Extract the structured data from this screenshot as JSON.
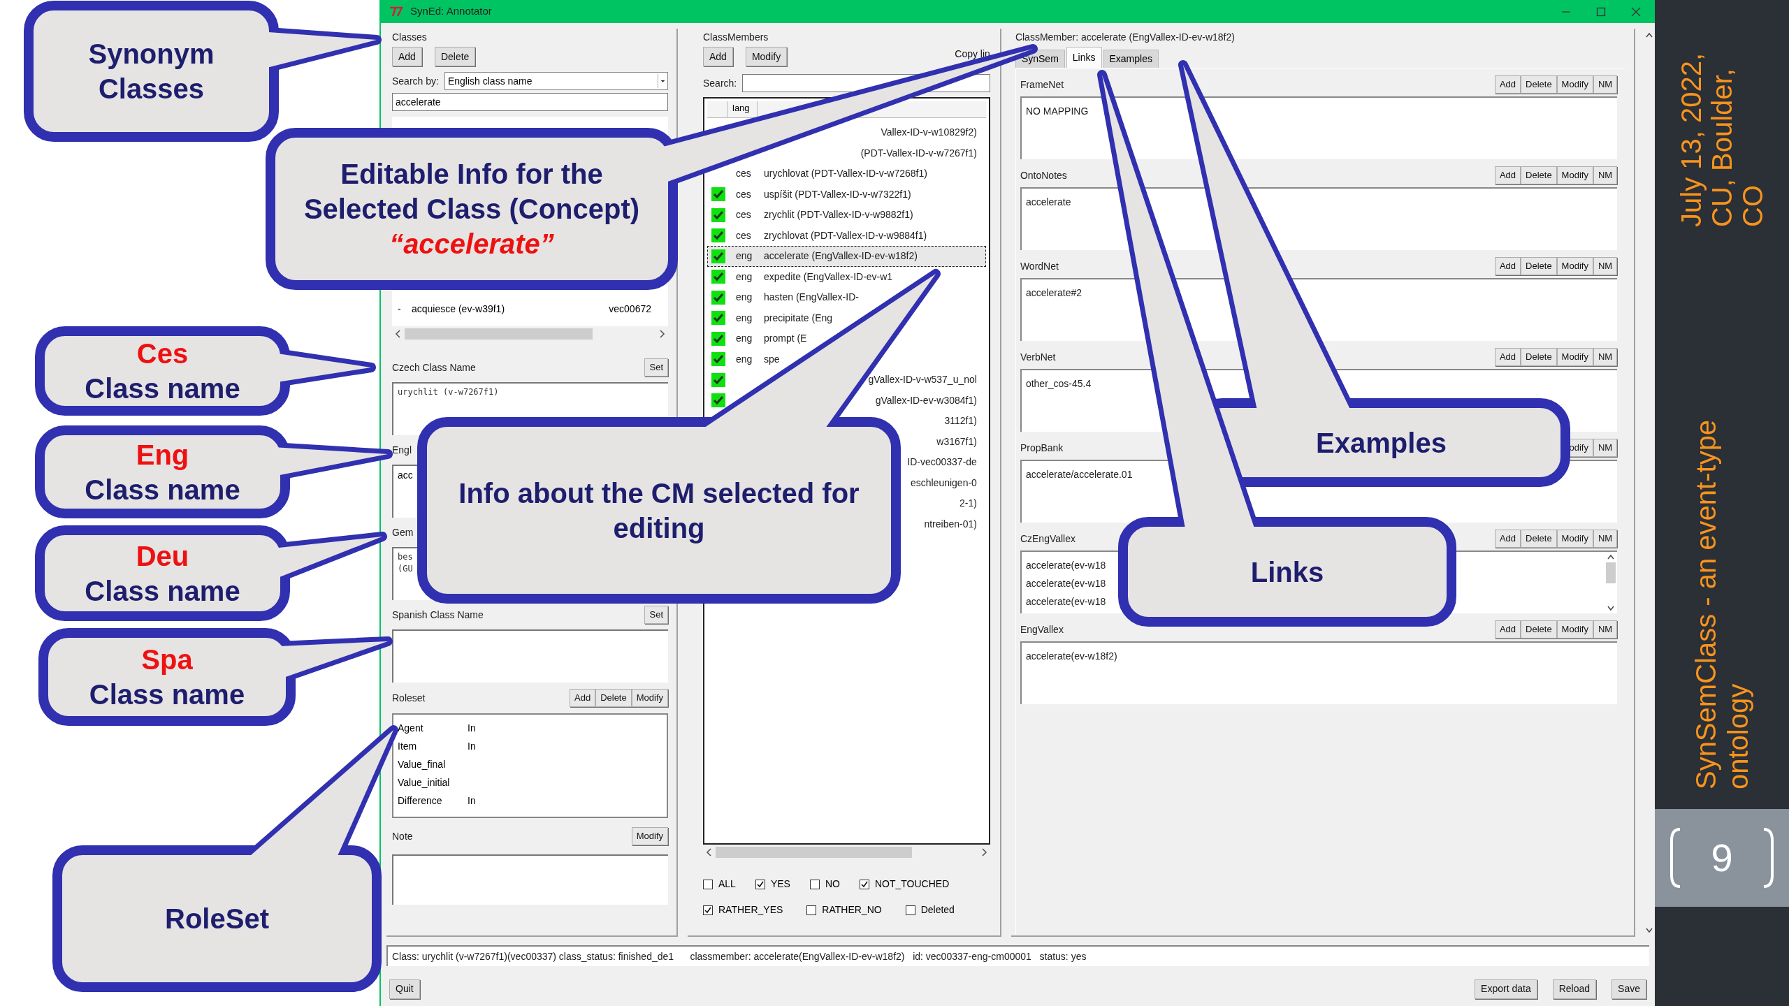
{
  "window": {
    "title": "SynEd: Annotator"
  },
  "classes": {
    "label": "Classes",
    "buttons": [
      "Add",
      "Delete"
    ],
    "search_by_label": "Search by:",
    "search_by_value": "English class name",
    "search_value": "accelerate",
    "rows": [
      {
        "mark": "-",
        "name": "acquiesce (ev-w39f1)",
        "id": "vec00672"
      }
    ],
    "name_fields": [
      {
        "label": "Czech Class Name",
        "button": "Set",
        "lines": [
          "urychlit (v-w7267f1)"
        ],
        "kind": "mono"
      },
      {
        "label": "Engl",
        "lines": [
          "acc"
        ],
        "kind": "plain"
      },
      {
        "label": "Gem",
        "lines": [
          "bes",
          "(GU"
        ],
        "kind": "mono"
      },
      {
        "label": "Spanish Class Name",
        "button": "Set",
        "kind": "plain"
      }
    ],
    "roleset": {
      "label": "Roleset",
      "buttons": [
        "Add",
        "Delete",
        "Modify"
      ],
      "roles": [
        {
          "name": "Agent",
          "tag": "In"
        },
        {
          "name": "Item",
          "tag": "In"
        },
        {
          "name": "Value_final"
        },
        {
          "name": "Value_initial"
        },
        {
          "name": "Difference",
          "tag": "In"
        }
      ]
    },
    "note": {
      "label": "Note",
      "button": "Modify"
    }
  },
  "class_members": {
    "label": "ClassMembers",
    "buttons": [
      "Add",
      "Modify"
    ],
    "copy_button": "Copy lin",
    "search_label": "Search:",
    "columns": [
      "lang"
    ],
    "rows": [
      {
        "kind": "clipped",
        "text": "Vallex-ID-v-w10829f2)",
        "selected": false
      },
      {
        "kind": "clipped",
        "text": "(PDT-Vallex-ID-v-w7267f1)",
        "selected": false
      },
      {
        "kind": "full",
        "lang": "ces",
        "text": "urychlovat (PDT-Vallex-ID-v-w7268f1)",
        "selected": false
      },
      {
        "kind": "full",
        "checked": true,
        "lang": "ces",
        "text": "uspíšit (PDT-Vallex-ID-v-w7322f1)",
        "selected": false
      },
      {
        "kind": "full",
        "checked": true,
        "lang": "ces",
        "text": "zrychlit (PDT-Vallex-ID-v-w9882f1)",
        "selected": false
      },
      {
        "kind": "full",
        "checked": true,
        "lang": "ces",
        "text": "zrychlovat (PDT-Vallex-ID-v-w9884f1)",
        "selected": false
      },
      {
        "kind": "full",
        "checked": true,
        "lang": "eng",
        "text": "accelerate (EngVallex-ID-ev-w18f2)",
        "selected": true
      },
      {
        "kind": "full",
        "checked": true,
        "lang": "eng",
        "text": "expedite (EngVallex-ID-ev-w1",
        "selected": false
      },
      {
        "kind": "full",
        "checked": true,
        "lang": "eng",
        "text": "hasten (EngVallex-ID-",
        "selected": false
      },
      {
        "kind": "full",
        "checked": true,
        "lang": "eng",
        "text": "precipitate (Eng",
        "selected": false
      },
      {
        "kind": "full",
        "checked": true,
        "lang": "eng",
        "text": "prompt (E",
        "selected": false
      },
      {
        "kind": "full",
        "checked": true,
        "lang": "eng",
        "text": "spe",
        "selected": false
      },
      {
        "kind": "clipped",
        "checked": true,
        "text": "gVallex-ID-v-w537_u_nol",
        "selected": false
      },
      {
        "kind": "clipped",
        "checked": true,
        "text": "gVallex-ID-ev-w3084f1)",
        "selected": false
      },
      {
        "kind": "clipped",
        "text": "3112f1)",
        "selected": false
      },
      {
        "kind": "clipped",
        "text": "w3167f1)",
        "selected": false
      },
      {
        "kind": "clipped",
        "text": "ID-vec00337-de",
        "selected": false
      },
      {
        "kind": "clipped",
        "text": "eschleunigen-0",
        "selected": false
      },
      {
        "kind": "clipped",
        "text": "2-1)",
        "selected": false
      },
      {
        "kind": "clipped",
        "text": "ntreiben-01)",
        "selected": false
      }
    ],
    "filters": [
      {
        "label": "ALL",
        "checked": false
      },
      {
        "label": "YES",
        "checked": true
      },
      {
        "label": "NO",
        "checked": false
      },
      {
        "label": "NOT_TOUCHED",
        "checked": true
      },
      {
        "label": "RATHER_YES",
        "checked": true
      },
      {
        "label": "RATHER_NO",
        "checked": false
      },
      {
        "label": "Deleted",
        "checked": false
      }
    ]
  },
  "class_member": {
    "title": "ClassMember: accelerate (EngVallex-ID-ev-w18f2)",
    "tabs": [
      {
        "label": "SynSem",
        "selected": false
      },
      {
        "label": "Links",
        "selected": true
      },
      {
        "label": "Examples",
        "selected": false
      }
    ],
    "sections": [
      {
        "label": "FrameNet",
        "buttons": [
          "Add",
          "Delete",
          "Modify",
          "NM"
        ],
        "lines": [
          "NO MAPPING"
        ]
      },
      {
        "label": "OntoNotes",
        "buttons": [
          "Add",
          "Delete",
          "Modify",
          "NM"
        ],
        "lines": [
          "accelerate"
        ]
      },
      {
        "label": "WordNet",
        "buttons": [
          "Add",
          "Delete",
          "Modify",
          "NM"
        ],
        "lines": [
          "accelerate#2"
        ]
      },
      {
        "label": "VerbNet",
        "buttons": [
          "Add",
          "Delete",
          "Modify",
          "NM"
        ],
        "lines": [
          "other_cos-45.4"
        ]
      },
      {
        "label": "PropBank",
        "buttons": [
          "odify",
          "NM"
        ],
        "lines": [
          "accelerate/accelerate.01"
        ]
      },
      {
        "label": "CzEngVallex",
        "buttons": [
          "Add",
          "Delete",
          "Modify",
          "NM"
        ],
        "lines": [
          "accelerate(ev-w18",
          "accelerate(ev-w18",
          "accelerate(ev-w18"
        ],
        "scrollable": true
      },
      {
        "label": "EngVallex",
        "buttons": [
          "Add",
          "Delete",
          "Modify",
          "NM"
        ],
        "lines": [
          "accelerate(ev-w18f2)"
        ]
      }
    ]
  },
  "status_bar": "Class: urychlit (v-w7267f1)(vec00337) class_status: finished_de1      classmember: accelerate(EngVallex-ID-ev-w18f2)   id: vec00337-eng-cm00001   status: yes",
  "bottom_left_buttons": [
    "Quit"
  ],
  "bottom_right_buttons": [
    "Export data",
    "Reload",
    "Save"
  ],
  "callouts": [
    {
      "parts": [
        {
          "kind": "plain",
          "text": "Synonym Classes"
        }
      ]
    },
    {
      "parts": [
        {
          "kind": "plain",
          "text": "Editable Info for the Selected Class (Concept)"
        },
        {
          "kind": "accent-italic",
          "text": "“accelerate”"
        }
      ]
    },
    {
      "parts": [
        {
          "kind": "accent",
          "text": "Ces"
        },
        {
          "kind": "plain",
          "text": "Class name"
        }
      ]
    },
    {
      "parts": [
        {
          "kind": "accent",
          "text": "Eng"
        },
        {
          "kind": "plain",
          "text": "Class name"
        }
      ]
    },
    {
      "parts": [
        {
          "kind": "accent",
          "text": "Deu"
        },
        {
          "kind": "plain",
          "text": "Class name"
        }
      ]
    },
    {
      "parts": [
        {
          "kind": "accent",
          "text": "Spa"
        },
        {
          "kind": "plain",
          "text": "Class name"
        }
      ]
    },
    {
      "parts": [
        {
          "kind": "plain",
          "text": "RoleSet"
        }
      ]
    },
    {
      "parts": [
        {
          "kind": "plain",
          "text": "Info about the CM selected for editing"
        }
      ]
    },
    {
      "parts": [
        {
          "kind": "plain",
          "text": "Examples"
        }
      ]
    },
    {
      "parts": [
        {
          "kind": "plain",
          "text": "Links"
        }
      ]
    }
  ],
  "slide": {
    "date": "July 13, 2022, CU, Boulder, CO",
    "topic": "SynSemClass - an event-type ontology",
    "page": "9"
  }
}
